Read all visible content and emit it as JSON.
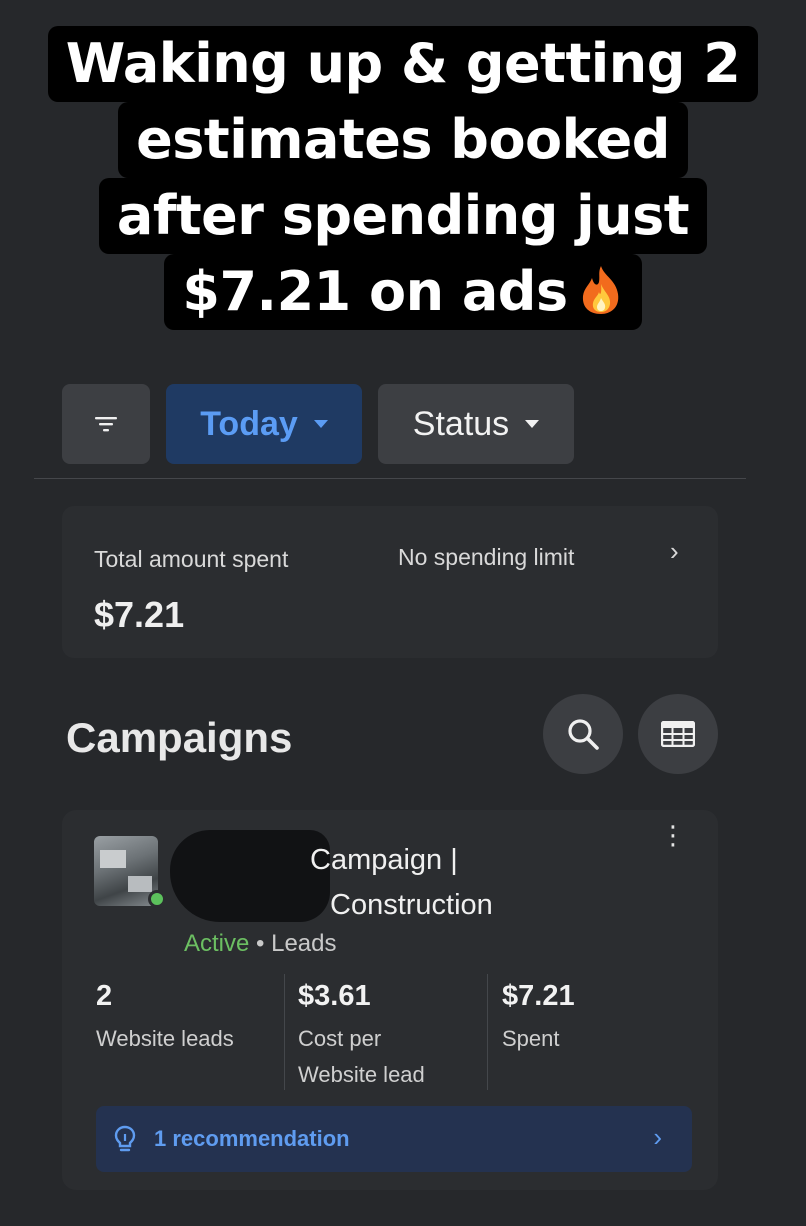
{
  "caption": {
    "lines": [
      "Waking up & getting 2",
      "estimates booked",
      "after spending  just",
      "$7.21 on ads"
    ],
    "emoji": "fire-icon"
  },
  "filters": {
    "filter_icon": "filter-icon",
    "date_label": "Today",
    "status_label": "Status"
  },
  "spend_card": {
    "label": "Total amount spent",
    "amount": "$7.21",
    "limit_text": "No spending limit",
    "chevron": "›"
  },
  "campaigns": {
    "heading": "Campaigns",
    "search_icon": "search-icon",
    "columns_icon": "table-columns-icon"
  },
  "campaign": {
    "name_line1": "Campaign |",
    "name_line2": "Construction",
    "status": "Active",
    "separator": "•",
    "objective": "Leads",
    "metrics": [
      {
        "value": "2",
        "label": "Website leads"
      },
      {
        "value": "$3.61",
        "label": "Cost per Website lead"
      },
      {
        "value": "$7.21",
        "label": "Spent"
      }
    ],
    "recommendation": "1 recommendation",
    "recommendation_chevron": "›",
    "menu": "⋮"
  },
  "colors": {
    "background": "#26282b",
    "card": "#2b2d30",
    "accent_blue": "#5b9cf4",
    "active_green": "#6cbf62"
  }
}
